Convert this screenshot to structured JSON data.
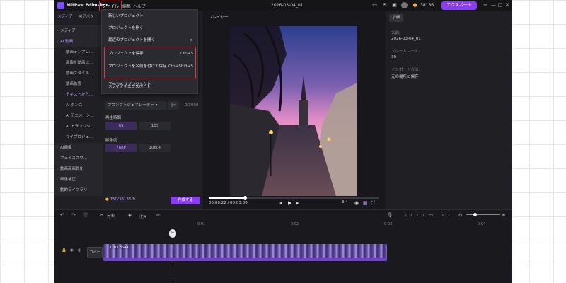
{
  "titlebar": {
    "app_name": "MitPaw Edimakor",
    "menu": [
      "ファイル",
      "編集",
      "ヘルプ"
    ],
    "doc_title": "2026-03-04_01",
    "coins": "38136",
    "export_label": "エクスポート"
  },
  "sidebar": {
    "tabs": [
      "メディア",
      "AIアバター"
    ],
    "items": [
      {
        "label": "メディア",
        "type": "group"
      },
      {
        "label": "AI 動画",
        "type": "group",
        "active": true
      },
      {
        "label": "動画テンプレ...",
        "type": "sub"
      },
      {
        "label": "画像を動画に...",
        "type": "sub"
      },
      {
        "label": "動画スタイル...",
        "type": "sub"
      },
      {
        "label": "動画拡張",
        "type": "sub"
      },
      {
        "label": "テキストから...",
        "type": "sub",
        "active": true
      },
      {
        "label": "AI ダンス",
        "type": "sub"
      },
      {
        "label": "AI アニメーシ...",
        "type": "sub"
      },
      {
        "label": "AI トランジシ...",
        "type": "sub"
      },
      {
        "label": "マイプロジェ...",
        "type": "sub"
      },
      {
        "label": "AI画像",
        "type": "group"
      },
      {
        "label": "フェイススワ...",
        "type": "group"
      },
      {
        "label": "動画高画質化",
        "type": "group"
      },
      {
        "label": "画像補正",
        "type": "group"
      },
      {
        "label": "動的ライブラリ",
        "type": "group"
      }
    ]
  },
  "content_panel": {
    "prompt_generator": "プロンプトジェネレーター",
    "char_count": "0/2000",
    "duration_label": "再生時間",
    "duration_options": [
      "6S",
      "10S"
    ],
    "resolution_label": "解像度",
    "resolution_options": [
      "768P",
      "1080P"
    ],
    "credits": "150/38136",
    "generate_label": "作成する"
  },
  "file_menu": {
    "items": [
      {
        "label": "新しいプロジェクト",
        "shortcut": ""
      },
      {
        "label": "プロジェクトを開く",
        "shortcut": ""
      },
      {
        "label": "最近のプロジェクトを開く",
        "shortcut": ">"
      },
      {
        "label": "プロジェクトを保存",
        "shortcut": "Ctrl+S"
      },
      {
        "label": "プロジェクトを名前を付けて保存",
        "shortcut": "Ctrl+Shift+S"
      },
      {
        "label": "アーカイブプロジェクト",
        "shortcut": ""
      },
      {
        "label": "メディアをエクスポート",
        "shortcut": ""
      }
    ]
  },
  "player": {
    "title": "プレイヤー",
    "progress": 0.21,
    "timecode": "00:00:22 / 00:03:00",
    "aspect": "3:4"
  },
  "properties": {
    "tab": "詳細",
    "fields": [
      {
        "label": "名前:",
        "value": "2026-03-04_01"
      },
      {
        "label": "フレームレート:",
        "value": "30"
      },
      {
        "label": "インポート方法:",
        "value": "元の場所に保存"
      }
    ]
  },
  "timeline": {
    "split_label": "分割",
    "ruler_ticks": [
      "0:01",
      "0:02",
      "0:03",
      "0:04"
    ],
    "cover_label": "カバー",
    "clip_label": "0:03 8644"
  },
  "colors": {
    "accent": "#8b3bf0",
    "highlight_box": "#e03535",
    "bg": "#1b1b1f"
  }
}
